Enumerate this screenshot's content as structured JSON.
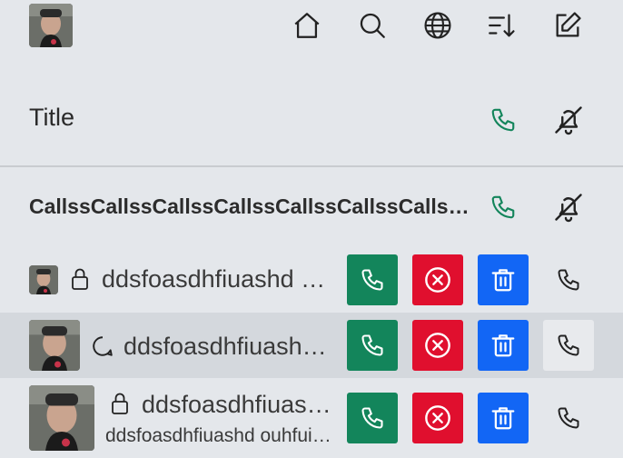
{
  "header": {
    "icons": [
      "home-icon",
      "search-icon",
      "globe-icon",
      "sort-icon",
      "compose-icon"
    ]
  },
  "title_row": {
    "title": "Title"
  },
  "section": {
    "label": "CallssCallssCallssCallssCallssCallssCallssCallss"
  },
  "rows": [
    {
      "name": "ddsfoasdhfiuashd ouhfuiasdhfiuahsdf",
      "status_icon": "lock-icon"
    },
    {
      "name": "ddsfoasdhfiuashd ouhfuiasdhfiuahsdf",
      "status_icon": "chat-bubble-icon"
    },
    {
      "name": "ddsfoasdhfiuashd ouhfuiasdhfiuahsdf",
      "subtitle": "ddsfoasdhfiuashd ouhfuiasdhfiuahsdf",
      "status_icon": "lock-icon"
    }
  ],
  "colors": {
    "accept": "#13855b",
    "decline": "#e00f2e",
    "delete": "#1266f5",
    "background": "#e4e7eb",
    "highlight": "#d4d8dd"
  }
}
